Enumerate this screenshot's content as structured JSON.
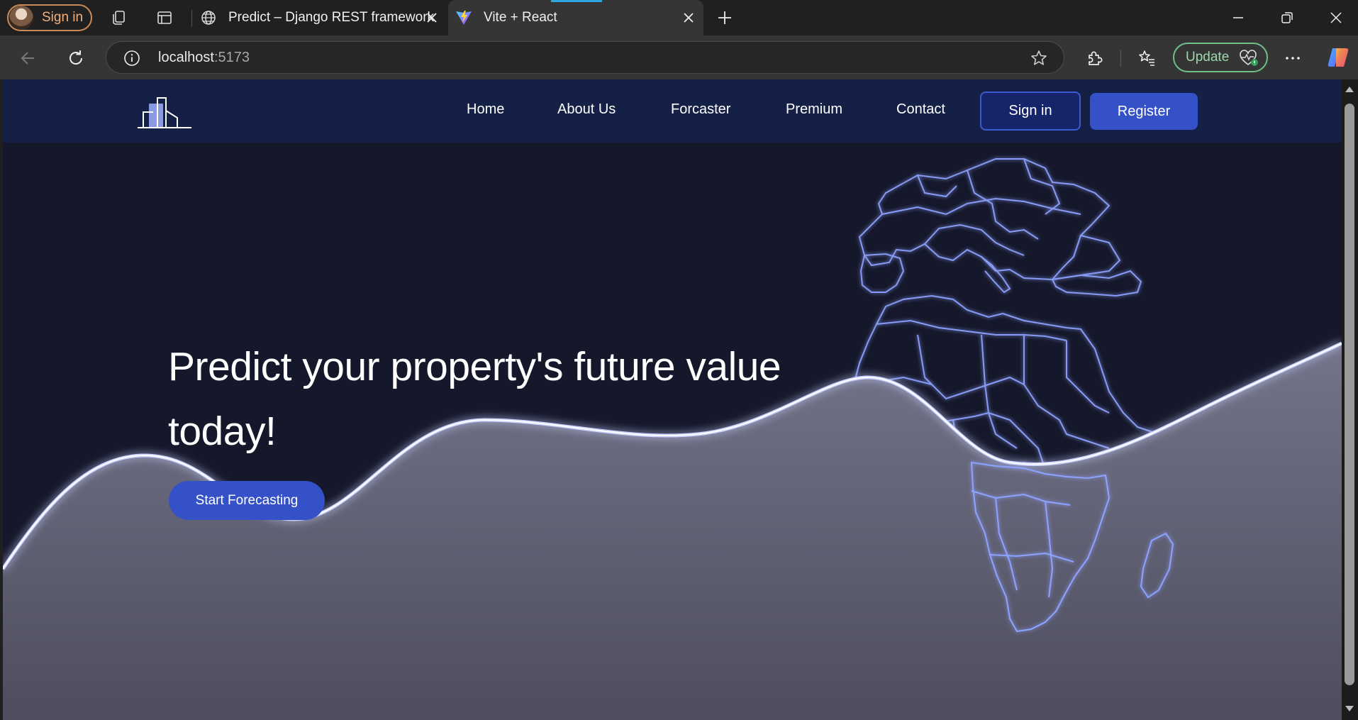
{
  "browser": {
    "profile_label": "Sign in",
    "tabs": [
      {
        "title": "Predict – Django REST framework",
        "icon": "globe-icon",
        "active": false
      },
      {
        "title": "Vite + React",
        "icon": "vite-icon",
        "active": true
      }
    ],
    "address": {
      "host": "localhost",
      "port": ":5173"
    },
    "update_label": "Update"
  },
  "site": {
    "nav": {
      "links": [
        "Home",
        "About Us",
        "Forcaster",
        "Premium",
        "Contact"
      ],
      "signin_label": "Sign in",
      "register_label": "Register"
    },
    "hero": {
      "title_line1": "Predict your property's future value",
      "title_line2": "today!",
      "cta_label": "Start Forecasting"
    }
  },
  "colors": {
    "header_bg": "#142045",
    "page_bg": "#15172a",
    "accent": "#3451c7",
    "glow": "#8fa4ff"
  }
}
